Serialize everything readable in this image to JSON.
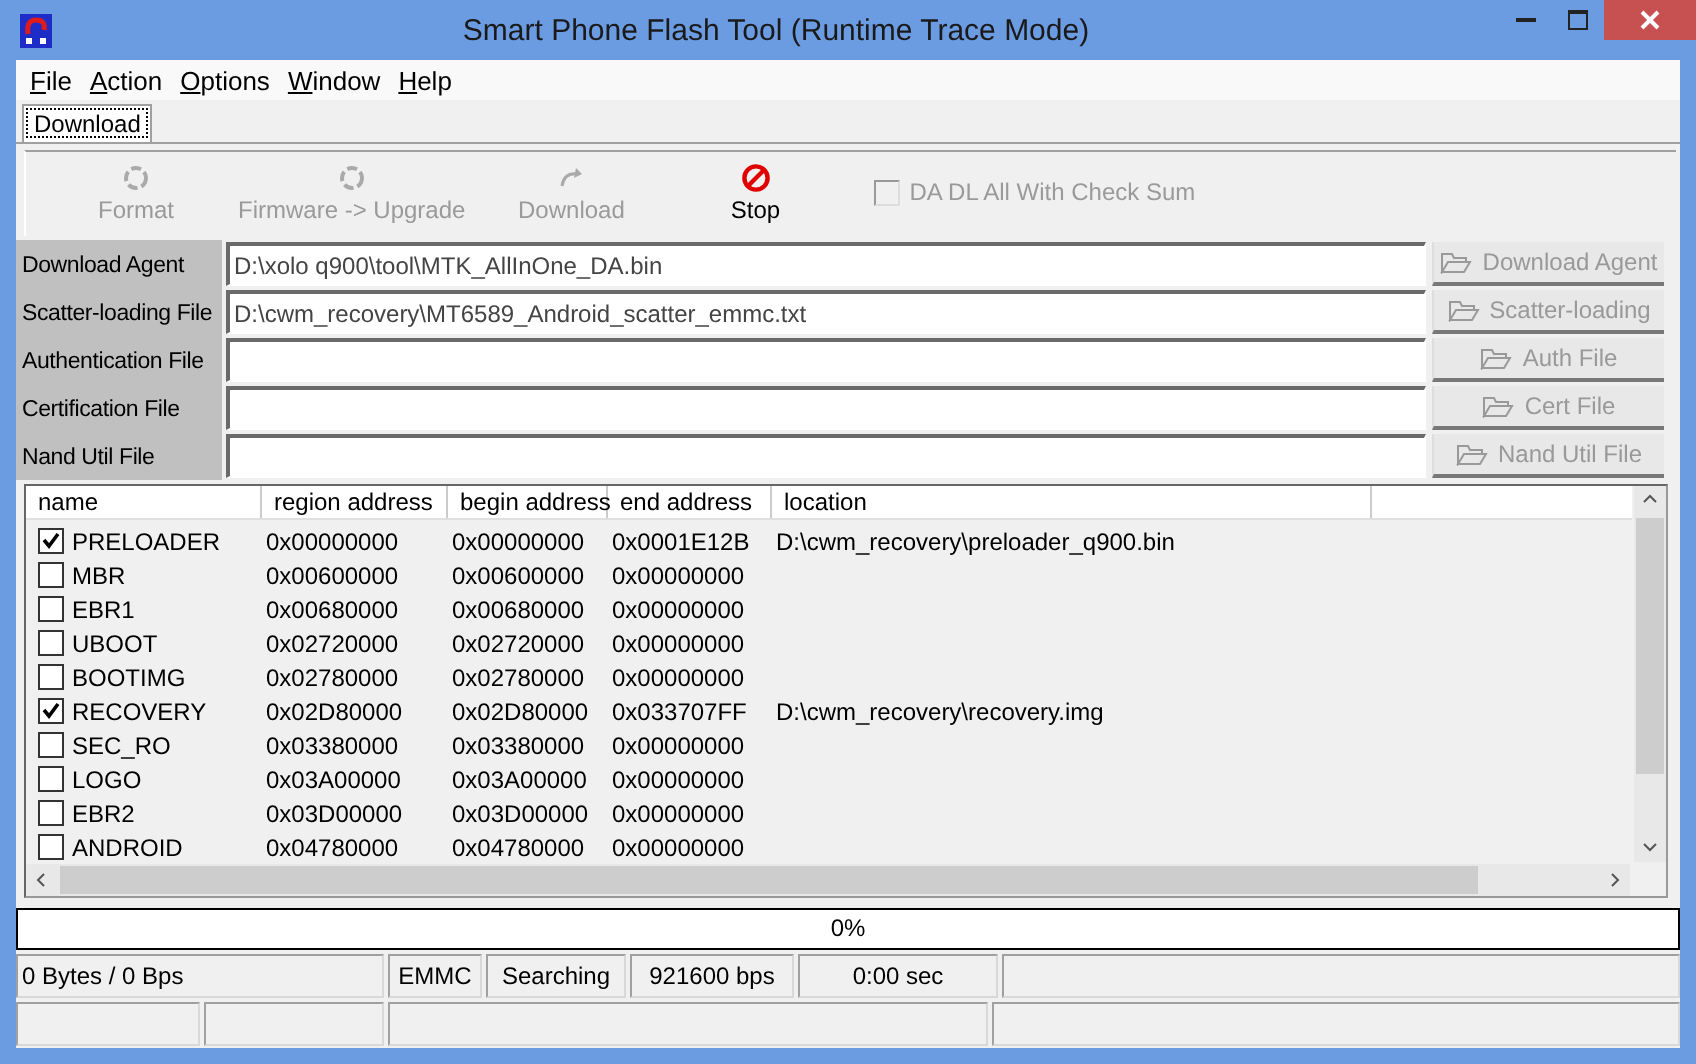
{
  "window": {
    "title": "Smart Phone Flash Tool (Runtime Trace Mode)"
  },
  "menu": [
    "File",
    "Action",
    "Options",
    "Window",
    "Help"
  ],
  "tabs": [
    {
      "label": "Download",
      "selected": true
    }
  ],
  "toolbar": [
    {
      "kind": "format",
      "label": "Format",
      "disabled": true
    },
    {
      "kind": "firmware",
      "label": "Firmware -> Upgrade",
      "disabled": true
    },
    {
      "kind": "download",
      "label": "Download",
      "disabled": true
    },
    {
      "kind": "stop",
      "label": "Stop",
      "disabled": false
    }
  ],
  "checksum_option": {
    "label": "DA DL All With Check Sum",
    "checked": false,
    "disabled": true
  },
  "files": [
    {
      "label": "Download Agent",
      "value": "D:\\xolo q900\\tool\\MTK_AllInOne_DA.bin",
      "button": "Download Agent",
      "disabled": true
    },
    {
      "label": "Scatter-loading File",
      "value": "D:\\cwm_recovery\\MT6589_Android_scatter_emmc.txt",
      "button": "Scatter-loading",
      "disabled": true
    },
    {
      "label": "Authentication File",
      "button": "Auth File",
      "disabled": true
    },
    {
      "label": "Certification File",
      "button": "Cert File",
      "disabled": true
    },
    {
      "label": "Nand Util File",
      "button": "Nand Util File",
      "disabled": true
    }
  ],
  "table": {
    "columns": [
      "name",
      "region address",
      "begin address",
      "end address",
      "location"
    ],
    "rows": [
      {
        "checked": true,
        "cells": [
          "PRELOADER",
          "0x00000000",
          "0x00000000",
          "0x0001E12B",
          "D:\\cwm_recovery\\preloader_q900.bin"
        ]
      },
      {
        "checked": false,
        "cells": [
          "MBR",
          "0x00600000",
          "0x00600000",
          "0x00000000",
          ""
        ]
      },
      {
        "checked": false,
        "cells": [
          "EBR1",
          "0x00680000",
          "0x00680000",
          "0x00000000",
          ""
        ]
      },
      {
        "checked": false,
        "cells": [
          "UBOOT",
          "0x02720000",
          "0x02720000",
          "0x00000000",
          ""
        ]
      },
      {
        "checked": false,
        "cells": [
          "BOOTIMG",
          "0x02780000",
          "0x02780000",
          "0x00000000",
          ""
        ]
      },
      {
        "checked": true,
        "cells": [
          "RECOVERY",
          "0x02D80000",
          "0x02D80000",
          "0x033707FF",
          "D:\\cwm_recovery\\recovery.img"
        ]
      },
      {
        "checked": false,
        "cells": [
          "SEC_RO",
          "0x03380000",
          "0x03380000",
          "0x00000000",
          ""
        ]
      },
      {
        "checked": false,
        "cells": [
          "LOGO",
          "0x03A00000",
          "0x03A00000",
          "0x00000000",
          ""
        ]
      },
      {
        "checked": false,
        "cells": [
          "EBR2",
          "0x03D00000",
          "0x03D00000",
          "0x00000000",
          ""
        ]
      },
      {
        "checked": false,
        "cells": [
          "ANDROID",
          "0x04780000",
          "0x04780000",
          "0x00000000",
          ""
        ]
      }
    ]
  },
  "progress": {
    "level": 0,
    "text": "0%"
  },
  "status_bar": [
    "0 Bytes / 0 Bps",
    "EMMC",
    "Searching",
    "921600 bps",
    "0:00 sec"
  ]
}
